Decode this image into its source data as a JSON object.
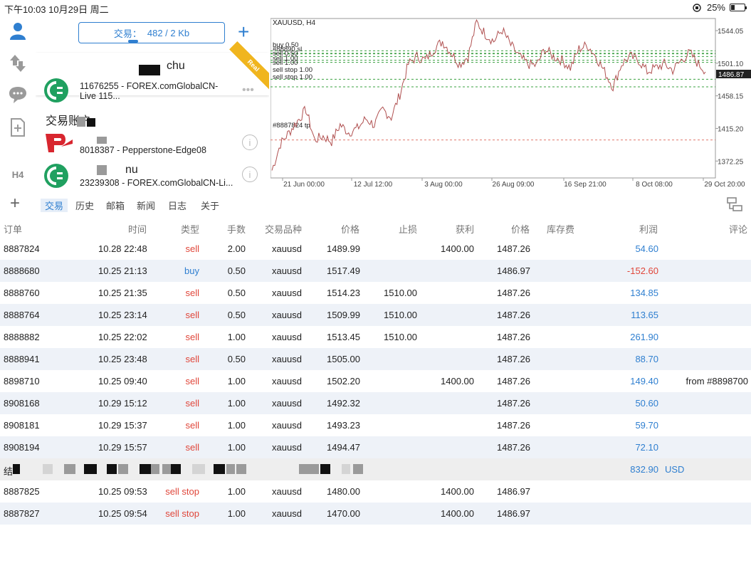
{
  "status_bar": {
    "time_date": "下午10:03   10月29日 周二",
    "battery": "25%",
    "battery_level": 0.25
  },
  "accounts": {
    "trade_label": "交易：",
    "trade_stats": "482 / 2 Kb",
    "items": [
      {
        "name": "chu",
        "number": "11676255 - FOREX.comGlobalCN-",
        "number2": "Live 115...",
        "badge": "Real"
      },
      {
        "group": "交易账户"
      },
      {
        "name": "",
        "number": "8018387 - Pepperstone-Edge08"
      },
      {
        "name": "nu",
        "number": "23239308 - FOREX.comGlobalCN-Li..."
      }
    ]
  },
  "rail": {
    "h4_label": "H4"
  },
  "chart": {
    "title": "XAUUSD, H4",
    "y_ticks": [
      "1544.05",
      "1501.10",
      "1458.15",
      "1415.20",
      "1372.25"
    ],
    "x_ticks": [
      "21 Jun 00:00",
      "12 Jul 12:00",
      "3 Aug 00:00",
      "26 Aug 09:00",
      "16 Sep 21:00",
      "8 Oct 08:00",
      "29 Oct 20:00"
    ],
    "current_price": "1486.87",
    "line_labels": [
      "buy 0.50",
      "#88890 sl",
      "sell 0.50",
      "sell 1.00",
      "sell 1.00",
      "sell stop 1.00",
      "sell stop 1.00",
      "#8887824 tp"
    ]
  },
  "chart_data": {
    "type": "line",
    "title": "XAUUSD, H4",
    "xlabel": "",
    "ylabel": "",
    "x": [
      "21 Jun 00:00",
      "12 Jul 12:00",
      "3 Aug 00:00",
      "26 Aug 09:00",
      "16 Sep 21:00",
      "8 Oct 08:00",
      "29 Oct 20:00"
    ],
    "ylim": [
      1350,
      1560
    ],
    "series": [
      {
        "values": [
          1360,
          1395,
          1410,
          1425,
          1440,
          1400,
          1405,
          1398,
          1420,
          1410,
          1415,
          1428,
          1420,
          1440,
          1430,
          1460,
          1500,
          1510,
          1505,
          1520,
          1530,
          1515,
          1500,
          1510,
          1555,
          1540,
          1530,
          1545,
          1525,
          1510,
          1500,
          1498,
          1520,
          1510,
          1505,
          1495,
          1520,
          1525,
          1510,
          1490,
          1470,
          1500,
          1510,
          1505,
          1490,
          1495,
          1500,
          1492,
          1505,
          1515,
          1500,
          1490
        ]
      }
    ],
    "horizontal_lines": [
      1517.49,
      1514.23,
      1509.99,
      1513.45,
      1505.0,
      1502.2,
      1480.0,
      1470.0,
      1400.0
    ],
    "grid": true
  },
  "tabs": {
    "items": [
      "交易",
      "历史",
      "邮箱",
      "新闻",
      "日志",
      "关于"
    ],
    "active": "交易"
  },
  "table": {
    "headers": [
      "订单",
      "时间",
      "类型",
      "手数",
      "交易品种",
      "价格",
      "止损",
      "获利",
      "价格",
      "库存费",
      "利润",
      "评论"
    ],
    "rows": [
      {
        "order": "8887824",
        "time": "10.28 22:48",
        "type": "sell",
        "lots": "2.00",
        "symbol": "xauusd",
        "price": "1489.99",
        "sl": "",
        "tp": "1400.00",
        "cur": "1487.26",
        "profit": "54.60",
        "comment": ""
      },
      {
        "order": "8888680",
        "time": "10.25 21:13",
        "type": "buy",
        "lots": "0.50",
        "symbol": "xauusd",
        "price": "1517.49",
        "sl": "",
        "tp": "",
        "cur": "1486.97",
        "profit": "-152.60",
        "comment": ""
      },
      {
        "order": "8888760",
        "time": "10.25 21:35",
        "type": "sell",
        "lots": "0.50",
        "symbol": "xauusd",
        "price": "1514.23",
        "sl": "1510.00",
        "tp": "",
        "cur": "1487.26",
        "profit": "134.85",
        "comment": ""
      },
      {
        "order": "8888764",
        "time": "10.25 23:14",
        "type": "sell",
        "lots": "0.50",
        "symbol": "xauusd",
        "price": "1509.99",
        "sl": "1510.00",
        "tp": "",
        "cur": "1487.26",
        "profit": "113.65",
        "comment": ""
      },
      {
        "order": "8888882",
        "time": "10.25 22:02",
        "type": "sell",
        "lots": "1.00",
        "symbol": "xauusd",
        "price": "1513.45",
        "sl": "1510.00",
        "tp": "",
        "cur": "1487.26",
        "profit": "261.90",
        "comment": ""
      },
      {
        "order": "8888941",
        "time": "10.25 23:48",
        "type": "sell",
        "lots": "0.50",
        "symbol": "xauusd",
        "price": "1505.00",
        "sl": "",
        "tp": "",
        "cur": "1487.26",
        "profit": "88.70",
        "comment": ""
      },
      {
        "order": "8898710",
        "time": "10.25 09:40",
        "type": "sell",
        "lots": "1.00",
        "symbol": "xauusd",
        "price": "1502.20",
        "sl": "",
        "tp": "1400.00",
        "cur": "1487.26",
        "profit": "149.40",
        "comment": "from #8898700"
      },
      {
        "order": "8908168",
        "time": "10.29 15:12",
        "type": "sell",
        "lots": "1.00",
        "symbol": "xauusd",
        "price": "1492.32",
        "sl": "",
        "tp": "",
        "cur": "1487.26",
        "profit": "50.60",
        "comment": ""
      },
      {
        "order": "8908181",
        "time": "10.29 15:37",
        "type": "sell",
        "lots": "1.00",
        "symbol": "xauusd",
        "price": "1493.23",
        "sl": "",
        "tp": "",
        "cur": "1487.26",
        "profit": "59.70",
        "comment": ""
      },
      {
        "order": "8908194",
        "time": "10.29 15:57",
        "type": "sell",
        "lots": "1.00",
        "symbol": "xauusd",
        "price": "1494.47",
        "sl": "",
        "tp": "",
        "cur": "1487.26",
        "profit": "72.10",
        "comment": ""
      }
    ],
    "total": {
      "label": "结",
      "profit": "832.90",
      "currency": "USD"
    },
    "pending": [
      {
        "order": "8887825",
        "time": "10.25 09:53",
        "type": "sell stop",
        "lots": "1.00",
        "symbol": "xauusd",
        "price": "1480.00",
        "tp": "1400.00",
        "cur": "1486.97"
      },
      {
        "order": "8887827",
        "time": "10.25 09:54",
        "type": "sell stop",
        "lots": "1.00",
        "symbol": "xauusd",
        "price": "1470.00",
        "tp": "1400.00",
        "cur": "1486.97"
      }
    ]
  }
}
